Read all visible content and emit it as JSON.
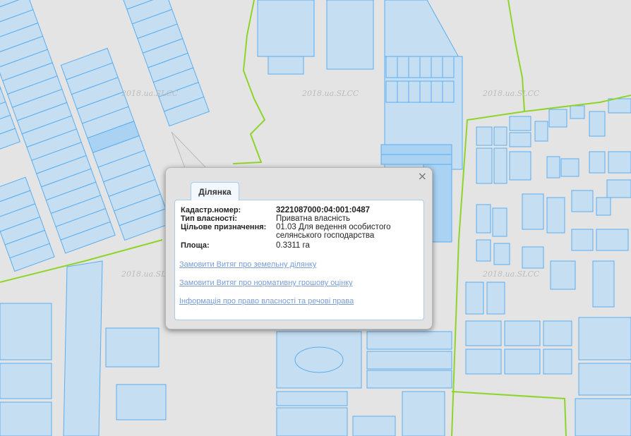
{
  "map": {
    "watermark": "2018.ua.SLCC",
    "colors": {
      "background": "#e4e4e4",
      "parcel_fill": "#c6def2",
      "parcel_stroke": "#5aaef0",
      "boundary": "#8ed42b"
    }
  },
  "popup": {
    "tab_label": "Ділянка",
    "close_label": "×",
    "fields": [
      {
        "label": "Кадастр.номер:",
        "value": "3221087000:04:001:0487"
      },
      {
        "label": "Тип власності:",
        "value": "Приватна власність"
      },
      {
        "label": "Цільове призначення:",
        "value": "01.03 Для ведення особистого селянського господарства"
      },
      {
        "label": "Площа:",
        "value": "0.3311 га"
      }
    ],
    "links": [
      "Замовити Витяг про земельну ділянку",
      "Замовити Витяг про нормативну грошову оцінку",
      "Інформація про право власності та речові права"
    ]
  }
}
